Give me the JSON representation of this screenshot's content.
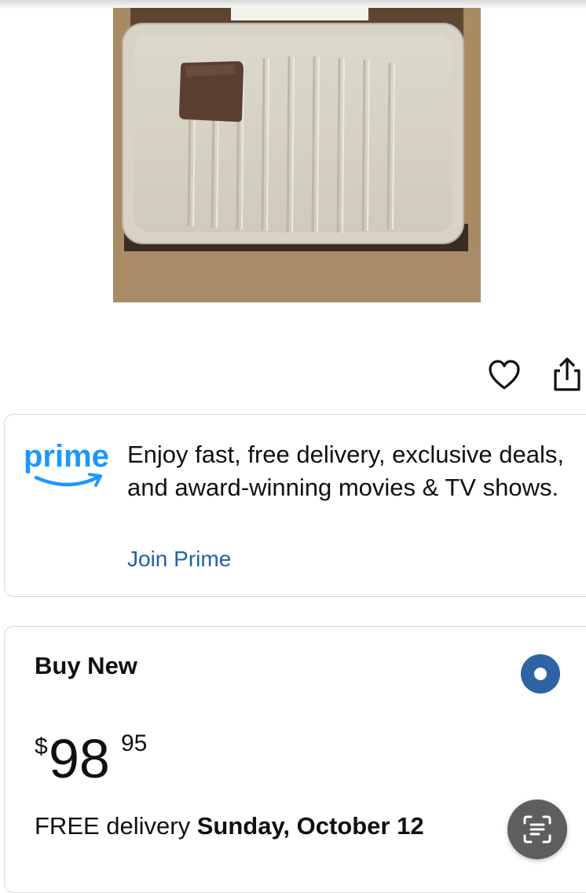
{
  "product": {
    "image_alt": "Photo of a beige ribbed tray with a small brown square tile, packed in a cardboard box"
  },
  "actions": {
    "wishlist_icon": "heart-outline-icon",
    "share_icon": "share-icon"
  },
  "prime": {
    "logo_text": "prime",
    "description": "Enjoy fast, free delivery, exclusive deals, and award-winning movies & TV shows.",
    "join_label": "Join Prime",
    "brand_color": "#1a98ff",
    "link_color": "#2162a1"
  },
  "buy_box": {
    "title": "Buy New",
    "selected": true,
    "radio_color": "#2e63a5",
    "price": {
      "symbol": "$",
      "whole": "98",
      "fraction": "95"
    },
    "delivery_prefix": "FREE delivery",
    "delivery_date": "Sunday, October 12"
  },
  "floating": {
    "scan_icon": "scan-text-icon"
  }
}
